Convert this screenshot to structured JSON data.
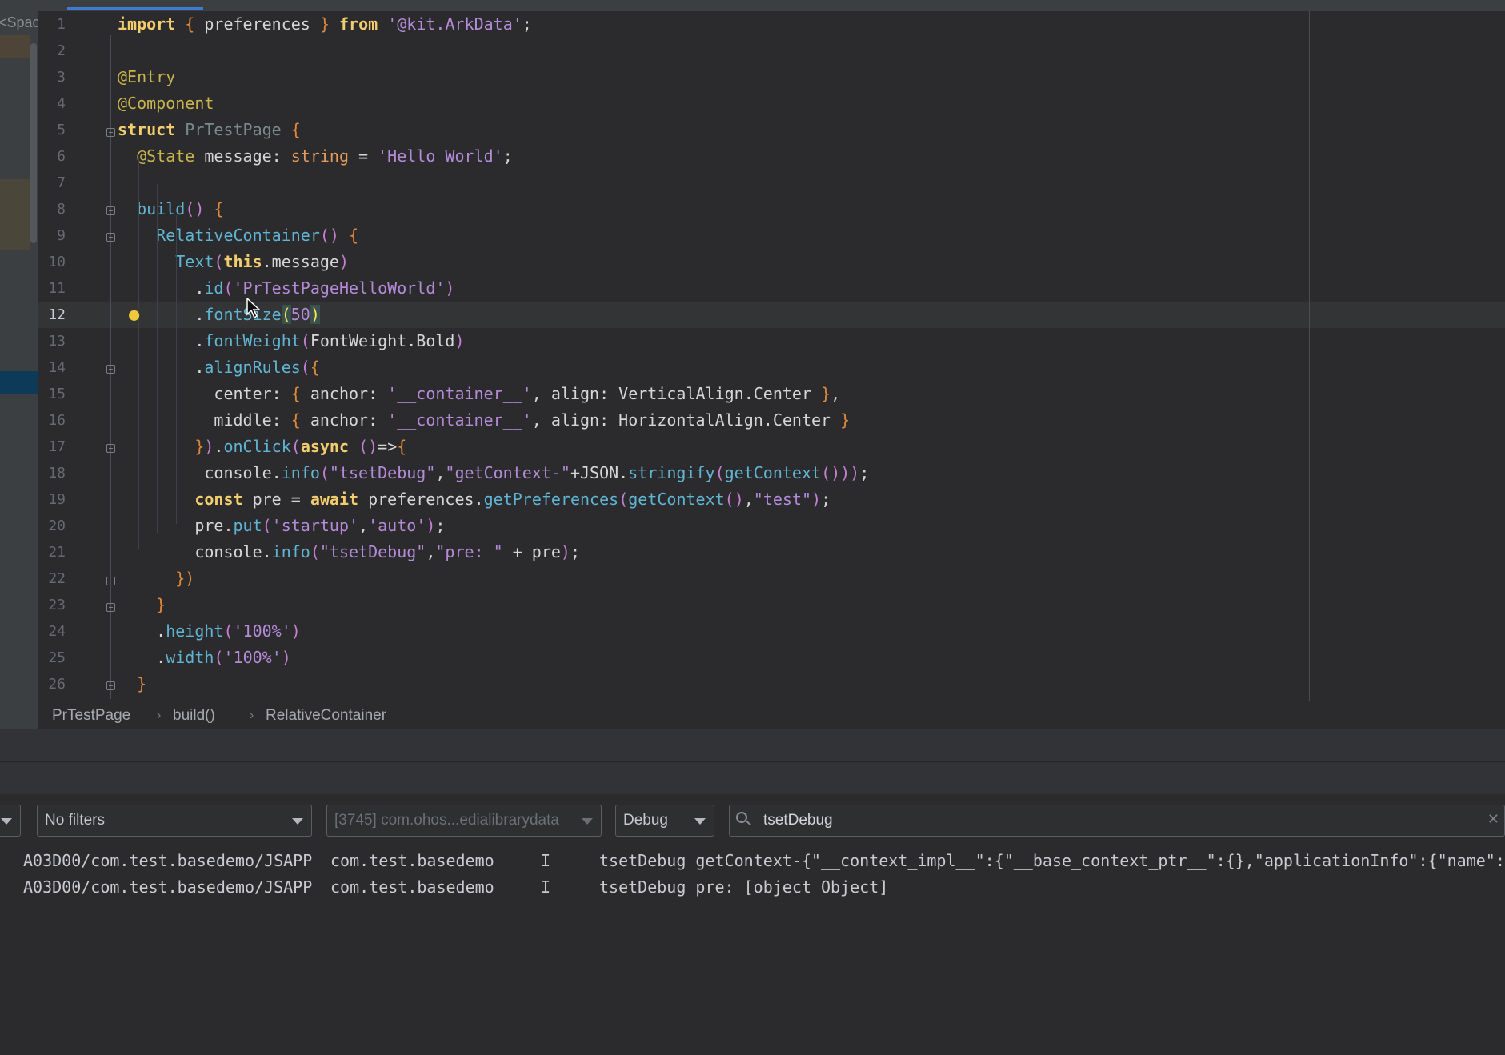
{
  "left_panel": {
    "label": "<Space"
  },
  "editor": {
    "current_line": 12,
    "lines": [
      {
        "n": "1",
        "segs": [
          {
            "t": "import",
            "c": "kw"
          },
          {
            "t": " "
          },
          {
            "t": "{",
            "c": "br"
          },
          {
            "t": " preferences "
          },
          {
            "t": "}",
            "c": "br"
          },
          {
            "t": " "
          },
          {
            "t": "from",
            "c": "kw"
          },
          {
            "t": " "
          },
          {
            "t": "'@kit.ArkData'",
            "c": "str"
          },
          {
            "t": ";"
          }
        ]
      },
      {
        "n": "2",
        "segs": []
      },
      {
        "n": "3",
        "segs": [
          {
            "t": "@Entry",
            "c": "ann"
          }
        ]
      },
      {
        "n": "4",
        "segs": [
          {
            "t": "@Component",
            "c": "ann"
          }
        ]
      },
      {
        "n": "5",
        "segs": [
          {
            "t": "struct",
            "c": "kw"
          },
          {
            "t": " "
          },
          {
            "t": "PrTestPage",
            "c": "cls"
          },
          {
            "t": " "
          },
          {
            "t": "{",
            "c": "br"
          }
        ]
      },
      {
        "n": "6",
        "segs": [
          {
            "t": "  "
          },
          {
            "t": "@State",
            "c": "ann"
          },
          {
            "t": " message: "
          },
          {
            "t": "string",
            "c": "typ"
          },
          {
            "t": " = "
          },
          {
            "t": "'Hello World'",
            "c": "str"
          },
          {
            "t": ";"
          }
        ]
      },
      {
        "n": "7",
        "segs": []
      },
      {
        "n": "8",
        "segs": [
          {
            "t": "  "
          },
          {
            "t": "build",
            "c": "fn"
          },
          {
            "t": "()",
            "c": "pr"
          },
          {
            "t": " "
          },
          {
            "t": "{",
            "c": "br"
          }
        ]
      },
      {
        "n": "9",
        "segs": [
          {
            "t": "    "
          },
          {
            "t": "RelativeContainer",
            "c": "fn"
          },
          {
            "t": "()",
            "c": "pr"
          },
          {
            "t": " "
          },
          {
            "t": "{",
            "c": "br"
          }
        ]
      },
      {
        "n": "10",
        "segs": [
          {
            "t": "      "
          },
          {
            "t": "Text",
            "c": "fn"
          },
          {
            "t": "(",
            "c": "pr"
          },
          {
            "t": "this",
            "c": "kw"
          },
          {
            "t": ".message"
          },
          {
            "t": ")",
            "c": "pr"
          }
        ]
      },
      {
        "n": "11",
        "segs": [
          {
            "t": "        ."
          },
          {
            "t": "id",
            "c": "fn"
          },
          {
            "t": "(",
            "c": "pr"
          },
          {
            "t": "'PrTestPageHelloWorld'",
            "c": "str"
          },
          {
            "t": ")",
            "c": "pr"
          }
        ]
      },
      {
        "n": "12",
        "segs": [
          {
            "t": "        ."
          },
          {
            "t": "fontSize",
            "c": "fn"
          },
          {
            "t": "(",
            "c": "bracket-hl"
          },
          {
            "t": "50",
            "c": "num"
          },
          {
            "t": ")",
            "c": "bracket-hl"
          }
        ]
      },
      {
        "n": "13",
        "segs": [
          {
            "t": "        ."
          },
          {
            "t": "fontWeight",
            "c": "fn"
          },
          {
            "t": "(",
            "c": "pr"
          },
          {
            "t": "FontWeight.Bold"
          },
          {
            "t": ")",
            "c": "pr"
          }
        ]
      },
      {
        "n": "14",
        "segs": [
          {
            "t": "        ."
          },
          {
            "t": "alignRules",
            "c": "fn"
          },
          {
            "t": "(",
            "c": "pr"
          },
          {
            "t": "{",
            "c": "br"
          }
        ]
      },
      {
        "n": "15",
        "segs": [
          {
            "t": "          center: "
          },
          {
            "t": "{",
            "c": "br"
          },
          {
            "t": " anchor: "
          },
          {
            "t": "'__container__'",
            "c": "str"
          },
          {
            "t": ", align: VerticalAlign.Center "
          },
          {
            "t": "}",
            "c": "br"
          },
          {
            "t": ","
          }
        ]
      },
      {
        "n": "16",
        "segs": [
          {
            "t": "          middle: "
          },
          {
            "t": "{",
            "c": "br"
          },
          {
            "t": " anchor: "
          },
          {
            "t": "'__container__'",
            "c": "str"
          },
          {
            "t": ", align: HorizontalAlign.Center "
          },
          {
            "t": "}",
            "c": "br"
          }
        ]
      },
      {
        "n": "17",
        "segs": [
          {
            "t": "        "
          },
          {
            "t": "}",
            "c": "br"
          },
          {
            "t": ")",
            "c": "pr"
          },
          {
            "t": "."
          },
          {
            "t": "onClick",
            "c": "fn"
          },
          {
            "t": "(",
            "c": "pr"
          },
          {
            "t": "async",
            "c": "kw"
          },
          {
            "t": " "
          },
          {
            "t": "()",
            "c": "pr"
          },
          {
            "t": "=>"
          },
          {
            "t": "{",
            "c": "br"
          }
        ]
      },
      {
        "n": "18",
        "segs": [
          {
            "t": "         console."
          },
          {
            "t": "info",
            "c": "fn"
          },
          {
            "t": "(",
            "c": "pr"
          },
          {
            "t": "\"tsetDebug\"",
            "c": "str"
          },
          {
            "t": ","
          },
          {
            "t": "\"getContext-\"",
            "c": "str"
          },
          {
            "t": "+JSON."
          },
          {
            "t": "stringify",
            "c": "fn"
          },
          {
            "t": "(",
            "c": "pr"
          },
          {
            "t": "getContext",
            "c": "fn"
          },
          {
            "t": "()))",
            "c": "pr"
          },
          {
            "t": ";"
          }
        ]
      },
      {
        "n": "19",
        "segs": [
          {
            "t": "        "
          },
          {
            "t": "const",
            "c": "kw"
          },
          {
            "t": " pre = "
          },
          {
            "t": "await",
            "c": "kw"
          },
          {
            "t": " preferences."
          },
          {
            "t": "getPreferences",
            "c": "fn"
          },
          {
            "t": "(",
            "c": "pr"
          },
          {
            "t": "getContext",
            "c": "fn"
          },
          {
            "t": "()",
            "c": "pr"
          },
          {
            "t": ","
          },
          {
            "t": "\"test\"",
            "c": "str"
          },
          {
            "t": ")",
            "c": "pr"
          },
          {
            "t": ";"
          }
        ]
      },
      {
        "n": "20",
        "segs": [
          {
            "t": "        pre."
          },
          {
            "t": "put",
            "c": "fn"
          },
          {
            "t": "(",
            "c": "pr"
          },
          {
            "t": "'startup'",
            "c": "str"
          },
          {
            "t": ","
          },
          {
            "t": "'auto'",
            "c": "str"
          },
          {
            "t": ")",
            "c": "pr"
          },
          {
            "t": ";"
          }
        ]
      },
      {
        "n": "21",
        "segs": [
          {
            "t": "        console."
          },
          {
            "t": "info",
            "c": "fn"
          },
          {
            "t": "(",
            "c": "pr"
          },
          {
            "t": "\"tsetDebug\"",
            "c": "str"
          },
          {
            "t": ","
          },
          {
            "t": "\"pre: \"",
            "c": "str"
          },
          {
            "t": " + pre"
          },
          {
            "t": ")",
            "c": "pr"
          },
          {
            "t": ";"
          }
        ]
      },
      {
        "n": "22",
        "segs": [
          {
            "t": "      "
          },
          {
            "t": "})",
            "c": "br"
          }
        ]
      },
      {
        "n": "23",
        "segs": [
          {
            "t": "    "
          },
          {
            "t": "}",
            "c": "br"
          }
        ]
      },
      {
        "n": "24",
        "segs": [
          {
            "t": "    ."
          },
          {
            "t": "height",
            "c": "fn"
          },
          {
            "t": "(",
            "c": "pr"
          },
          {
            "t": "'100%'",
            "c": "str"
          },
          {
            "t": ")",
            "c": "pr"
          }
        ]
      },
      {
        "n": "25",
        "segs": [
          {
            "t": "    ."
          },
          {
            "t": "width",
            "c": "fn"
          },
          {
            "t": "(",
            "c": "pr"
          },
          {
            "t": "'100%'",
            "c": "str"
          },
          {
            "t": ")",
            "c": "pr"
          }
        ]
      },
      {
        "n": "26",
        "segs": [
          {
            "t": "  "
          },
          {
            "t": "}",
            "c": "br"
          }
        ]
      }
    ]
  },
  "breadcrumb": [
    "PrTestPage",
    "build()",
    "RelativeContainer"
  ],
  "log_toolbar": {
    "filter": "No filters",
    "process": "[3745] com.ohos...edialibrarydata",
    "level": "Debug",
    "search": "tsetDebug"
  },
  "log_rows": [
    {
      "tag": "A03D00/com.test.basedemo/JSAPP",
      "pkg": "com.test.basedemo",
      "level": "I",
      "msg": "tsetDebug getContext-{\"__context_impl__\":{\"__base_context_ptr__\":{},\"applicationInfo\":{\"name\":\""
    },
    {
      "tag": "A03D00/com.test.basedemo/JSAPP",
      "pkg": "com.test.basedemo",
      "level": "I",
      "msg": "tsetDebug pre: [object Object]"
    }
  ],
  "icons": {
    "bulb": "lightbulb-icon",
    "search": "search-icon",
    "clear": "clear-icon",
    "fold": "fold-icon"
  }
}
